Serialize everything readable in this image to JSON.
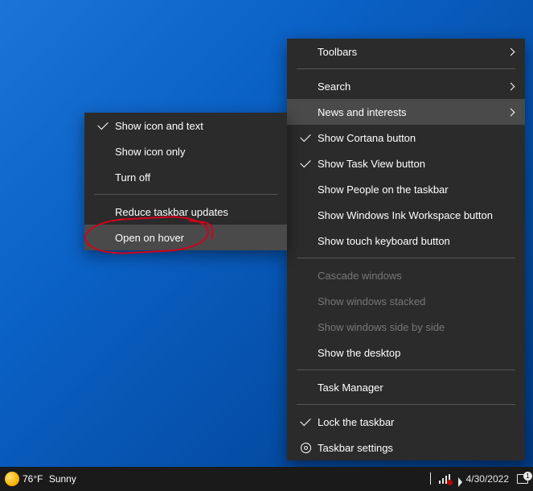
{
  "primary_menu": {
    "toolbars": "Toolbars",
    "search": "Search",
    "news": "News and interests",
    "show_cortana": "Show Cortana button",
    "show_taskview": "Show Task View button",
    "people": "Show People on the taskbar",
    "ink": "Show Windows Ink Workspace button",
    "touch_kb": "Show touch keyboard button",
    "cascade": "Cascade windows",
    "stacked": "Show windows stacked",
    "sidebyside": "Show windows side by side",
    "desktop": "Show the desktop",
    "taskmgr": "Task Manager",
    "lock": "Lock the taskbar",
    "settings": "Taskbar settings"
  },
  "sub_menu": {
    "icon_text": "Show icon and text",
    "icon_only": "Show icon only",
    "turn_off": "Turn off",
    "reduce": "Reduce taskbar updates",
    "open_hover": "Open on hover"
  },
  "taskbar": {
    "temp": "76°F",
    "weather": "Sunny",
    "date": "4/30/2022",
    "notif_count": "1"
  },
  "colors": {
    "menu_bg": "#2b2b2b",
    "hover": "#4a4a4a",
    "annotation": "#d4001a"
  }
}
